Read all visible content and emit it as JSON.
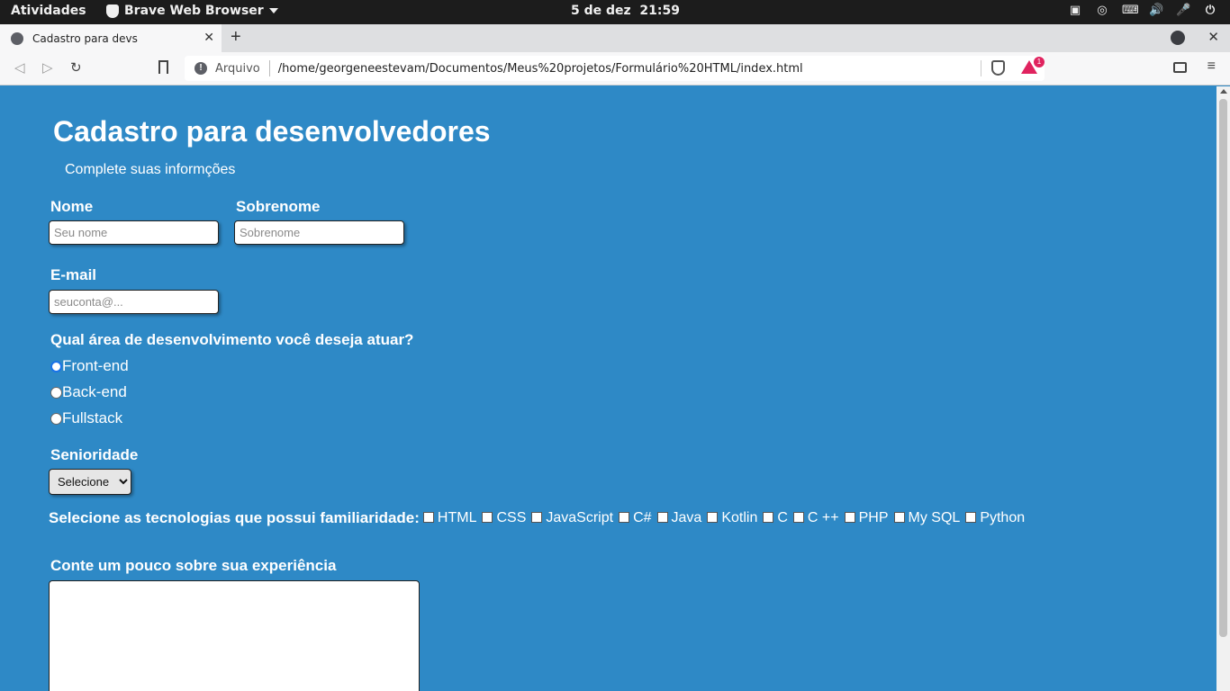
{
  "system": {
    "activities": "Atividades",
    "app_name": "Brave Web Browser",
    "date": "5 de dez",
    "time": "21:59",
    "tray_icons": [
      "screen-share-icon",
      "obs-icon",
      "keyboard-icon",
      "volume-icon",
      "microphone-icon",
      "power-icon"
    ]
  },
  "browser": {
    "tab_title": "Cadastro para devs",
    "url_scheme": "Arquivo",
    "url_path": "/home/georgeneestevam/Documentos/Meus%20projetos/Formulário%20HTML/index.html",
    "rewards_badge": "1"
  },
  "form": {
    "title": "Cadastro para desenvolvedores",
    "subtitle": "Complete suas informções",
    "nome_label": "Nome",
    "nome_placeholder": "Seu nome",
    "sobrenome_label": "Sobrenome",
    "sobrenome_placeholder": "Sobrenome",
    "email_label": "E-mail",
    "email_placeholder": "seuconta@...",
    "area_question": "Qual área de desenvolvimento você deseja atuar?",
    "areas": [
      "Front-end",
      "Back-end",
      "Fullstack"
    ],
    "seniority_label": "Senioridade",
    "seniority_selected": "Selecione",
    "tech_label": "Selecione as tecnologias que possui familiaridade:",
    "technologies": [
      "HTML",
      "CSS",
      "JavaScript",
      "C#",
      "Java",
      "Kotlin",
      "C",
      "C ++",
      "PHP",
      "My SQL",
      "Python"
    ],
    "experience_label": "Conte um pouco sobre sua experiência"
  },
  "colors": {
    "page_background": "#2e89c6",
    "topbar": "#1c1c1c",
    "rewards": "#e0235f"
  }
}
